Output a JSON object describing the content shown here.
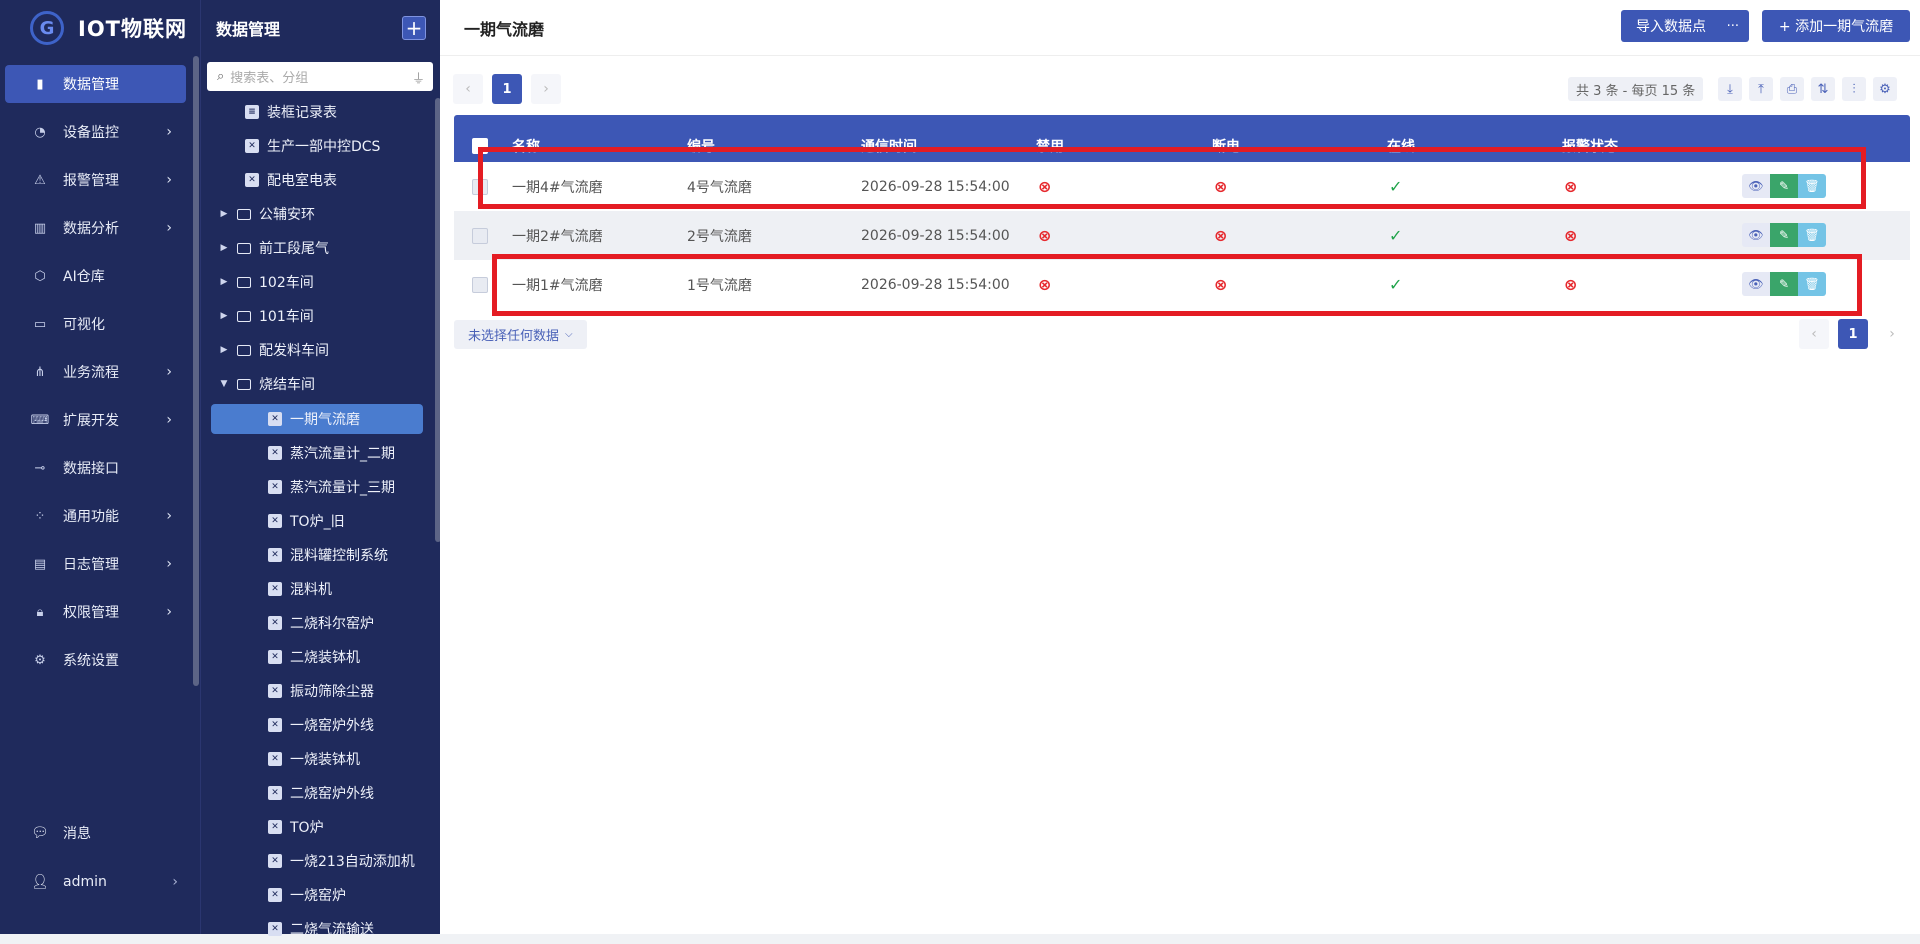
{
  "app": {
    "brand": "IOT物联网"
  },
  "nav": {
    "items": [
      {
        "label": "数据管理",
        "icon": "bar-chart-icon"
      },
      {
        "label": "设备监控",
        "icon": "gauge-icon"
      },
      {
        "label": "报警管理",
        "icon": "alarm-icon"
      },
      {
        "label": "数据分析",
        "icon": "analytics-icon"
      },
      {
        "label": "AI仓库",
        "icon": "ai-icon"
      },
      {
        "label": "可视化",
        "icon": "monitor-icon"
      },
      {
        "label": "业务流程",
        "icon": "flow-icon"
      },
      {
        "label": "扩展开发",
        "icon": "code-icon"
      },
      {
        "label": "数据接口",
        "icon": "plug-icon"
      },
      {
        "label": "通用功能",
        "icon": "apps-icon"
      },
      {
        "label": "日志管理",
        "icon": "log-icon"
      },
      {
        "label": "权限管理",
        "icon": "lock-icon"
      },
      {
        "label": "系统设置",
        "icon": "gear-icon"
      }
    ],
    "messages": "消息",
    "user": "admin"
  },
  "tree": {
    "title": "数据管理",
    "search_placeholder": "搜索表、分组",
    "nodes": [
      {
        "label": "装框记录表",
        "kind": "doc",
        "level": 1
      },
      {
        "label": "生产一部中控DCS",
        "kind": "doc",
        "level": 1
      },
      {
        "label": "配电室电表",
        "kind": "doc",
        "level": 1
      },
      {
        "label": "公辅安环",
        "kind": "folder",
        "level": 0
      },
      {
        "label": "前工段尾气",
        "kind": "folder",
        "level": 0
      },
      {
        "label": "102车间",
        "kind": "folder",
        "level": 0
      },
      {
        "label": "101车间",
        "kind": "folder",
        "level": 0
      },
      {
        "label": "配发料车间",
        "kind": "folder",
        "level": 0
      },
      {
        "label": "烧结车间",
        "kind": "folder-open",
        "level": 0
      },
      {
        "label": "一期气流磨",
        "kind": "doc",
        "level": 2,
        "selected": true
      },
      {
        "label": "蒸汽流量计_二期",
        "kind": "doc",
        "level": 2
      },
      {
        "label": "蒸汽流量计_三期",
        "kind": "doc",
        "level": 2
      },
      {
        "label": "TO炉_旧",
        "kind": "doc",
        "level": 2
      },
      {
        "label": "混料罐控制系统",
        "kind": "doc",
        "level": 2
      },
      {
        "label": "混料机",
        "kind": "doc",
        "level": 2
      },
      {
        "label": "二烧科尔窑炉",
        "kind": "doc",
        "level": 2
      },
      {
        "label": "二烧装钵机",
        "kind": "doc",
        "level": 2
      },
      {
        "label": "振动筛除尘器",
        "kind": "doc",
        "level": 2
      },
      {
        "label": "一烧窑炉外线",
        "kind": "doc",
        "level": 2
      },
      {
        "label": "一烧装钵机",
        "kind": "doc",
        "level": 2
      },
      {
        "label": "二烧窑炉外线",
        "kind": "doc",
        "level": 2
      },
      {
        "label": "TO炉",
        "kind": "doc",
        "level": 2
      },
      {
        "label": "一烧213自动添加机",
        "kind": "doc",
        "level": 2
      },
      {
        "label": "一烧窑炉",
        "kind": "doc",
        "level": 2
      },
      {
        "label": "二烧气流输送",
        "kind": "doc",
        "level": 2
      }
    ]
  },
  "main": {
    "title": "一期气流磨",
    "import_button": "导入数据点",
    "more_button": "···",
    "add_button": "+ 添加一期气流磨",
    "page_current": "1",
    "count_text": "共 3 条 - 每页 15 条",
    "columns": [
      "名称",
      "编号",
      "通信时间",
      "禁用",
      "断电",
      "在线",
      "报警状态"
    ],
    "rows": [
      {
        "name": "一期4#气流磨",
        "code": "4号气流磨",
        "time": "2026-09-28 15:54:00",
        "disabled": false,
        "power_off": false,
        "online": true,
        "alarm": false
      },
      {
        "name": "一期2#气流磨",
        "code": "2号气流磨",
        "time": "2026-09-28 15:54:00",
        "disabled": false,
        "power_off": false,
        "online": true,
        "alarm": false
      },
      {
        "name": "一期1#气流磨",
        "code": "1号气流磨",
        "time": "2026-09-28 15:54:00",
        "disabled": false,
        "power_off": false,
        "online": true,
        "alarm": false
      }
    ],
    "selection_text": "未选择任何数据"
  },
  "colors": {
    "accent": "#3d57b5",
    "sidebar": "#1f2a5c",
    "highlight": "#e41c23",
    "ok": "#1fa34a",
    "bad": "#e6292e"
  }
}
